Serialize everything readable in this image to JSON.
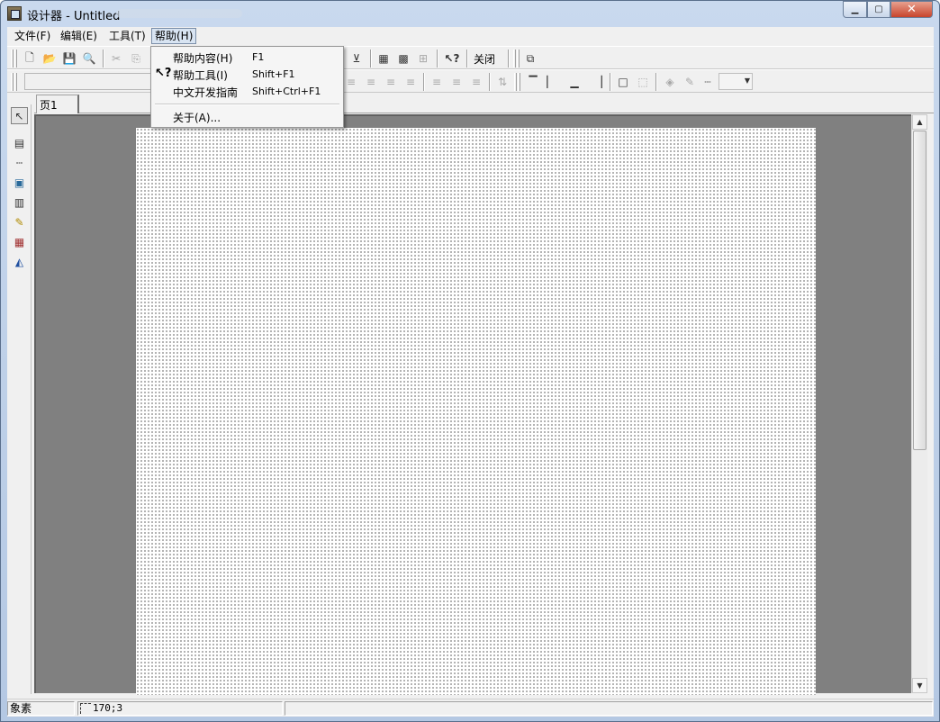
{
  "window": {
    "title": "设计器 - Untitled",
    "min_glyph": "▁",
    "max_glyph": "▢",
    "close_glyph": "✕"
  },
  "menubar": {
    "file": "文件(F)",
    "edit": "编辑(E)",
    "tools": "工具(T)",
    "help": "帮助(H)"
  },
  "help_menu": {
    "items": [
      {
        "label": "帮助内容(H)",
        "accel": "F1"
      },
      {
        "label": "帮助工具(I)",
        "accel": "Shift+F1"
      },
      {
        "label": "中文开发指南",
        "accel": "Shift+Ctrl+F1"
      },
      {
        "label": "关于(A)...",
        "accel": ""
      }
    ],
    "tool_icon_glyph": "↖?"
  },
  "toolbar1": {
    "close_label": "关闭",
    "icons": {
      "new": "🗋",
      "open": "📂",
      "save": "💾",
      "preview": "🔍",
      "cut": "✂",
      "copy": "⎘",
      "align_bottom": "⊻",
      "grid": "▦",
      "snap_grid": "▩",
      "layout": "⊞",
      "help_tool": "↖?",
      "export": "⧉"
    }
  },
  "toolbar2": {
    "icons": {
      "align_left": "≡",
      "align_center": "≡",
      "align_right": "≡",
      "justify": "≡",
      "valign_top": "≡",
      "valign_mid": "≡",
      "valign_bottom": "≡",
      "text_dir": "⇅",
      "line_top": "▔",
      "line_left": "▏",
      "line_bottom": "▁",
      "line_right": "▕",
      "border_box": "□",
      "border_dash": "⬚",
      "fill": "◈",
      "pen": "✎",
      "line_style": "┅"
    }
  },
  "tabs": [
    "页1"
  ],
  "palette": {
    "icons": {
      "select": "↖",
      "text": "▤",
      "line": "┄",
      "image": "▣",
      "memo": "▥",
      "highlight": "✎",
      "richtext": "▦",
      "shape": "◭"
    }
  },
  "scrollbar": {
    "up": "▲",
    "down": "▼"
  },
  "statusbar": {
    "unit": "象素",
    "position": "170;3",
    "message": ""
  }
}
